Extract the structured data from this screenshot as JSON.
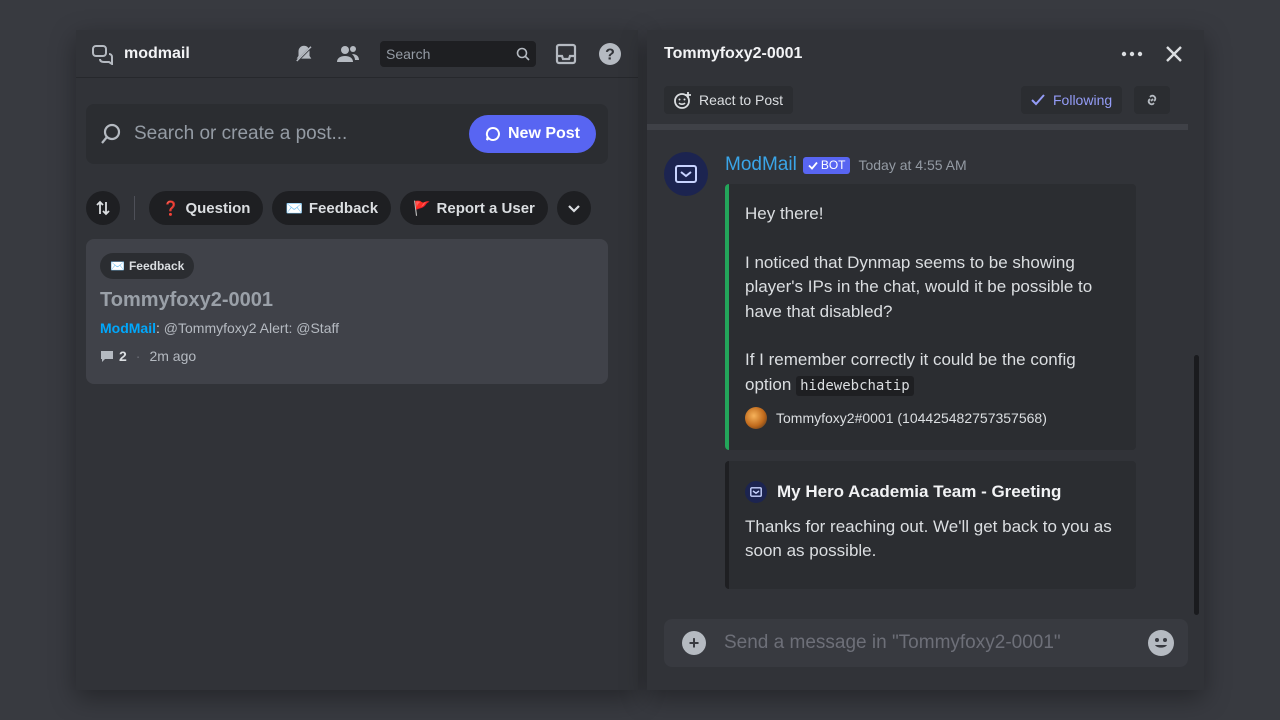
{
  "left": {
    "channel_name": "modmail",
    "search_placeholder": "Search",
    "search_post_placeholder": "Search or create a post...",
    "new_post_label": "New Post",
    "tags": [
      {
        "emoji": "❓",
        "label": "Question"
      },
      {
        "emoji": "✉️",
        "label": "Feedback"
      },
      {
        "emoji": "🚩",
        "label": "Report a User"
      }
    ],
    "post": {
      "tag_emoji": "✉️",
      "tag_label": "Feedback",
      "title": "Tommyfoxy2-0001",
      "author": "ModMail",
      "preview": "@Tommyfoxy2  Alert: @Staff",
      "reply_count": "2",
      "time": "2m ago"
    }
  },
  "right": {
    "thread_title": "Tommyfoxy2-0001",
    "react_label": "React to Post",
    "following_label": "Following",
    "message": {
      "author": "ModMail",
      "badge": "BOT",
      "time": "Today at 4:55 AM",
      "embed": {
        "greeting": "Hey there!",
        "body1": "I noticed that Dynmap seems to be showing player's IPs in the chat, would it be possible to have that disabled?",
        "body2": "If I remember correctly it could be the config option",
        "code": "hidewebchatip",
        "footer": "Tommyfoxy2#0001 (1044254827573575​68)"
      },
      "embed2": {
        "title": "My Hero Academia Team - Greeting",
        "body": "Thanks for reaching out. We'll get back to you as soon as possible."
      }
    },
    "composer_placeholder": "Send a message in \"Tommyfoxy2-0001\""
  },
  "colors": {
    "accent": "#5865f2",
    "following": "#949cf7",
    "embed_border": "#23a55a",
    "author_link": "#00a8fc"
  }
}
